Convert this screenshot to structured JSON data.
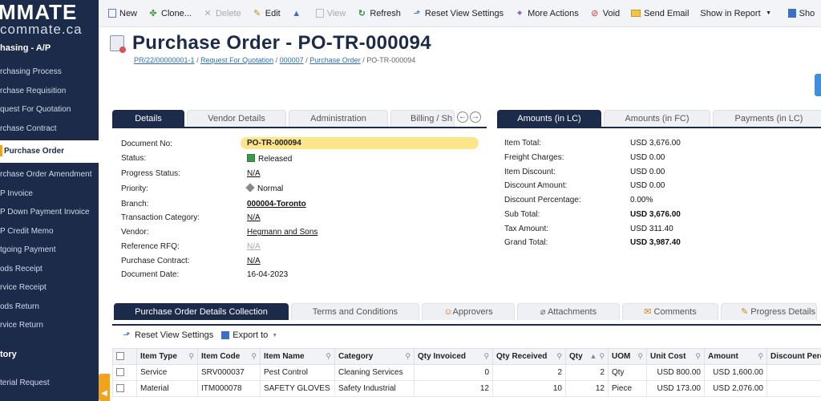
{
  "app": {
    "logo_main": "MMATE",
    "logo_sub": "commate.ca"
  },
  "sidebar": {
    "section": "hasing - A/P",
    "items": [
      {
        "label": "rchasing Process"
      },
      {
        "label": "rchase Requisition"
      },
      {
        "label": "quest For Quotation"
      },
      {
        "label": "rchase Contract"
      },
      {
        "label": "Purchase Order"
      },
      {
        "label": "rchase Order Amendment"
      },
      {
        "label": "P Invoice"
      },
      {
        "label": "P Down Payment Invoice"
      },
      {
        "label": "P Credit Memo"
      },
      {
        "label": "tgoing Payment"
      },
      {
        "label": "ods Receipt"
      },
      {
        "label": "rvice Receipt"
      },
      {
        "label": "ods Return"
      },
      {
        "label": "rvice Return"
      }
    ],
    "section2": "tory",
    "items2": [
      {
        "label": "terial Request"
      }
    ]
  },
  "toolbar": {
    "new": "New",
    "clone": "Clone...",
    "delete": "Delete",
    "edit": "Edit",
    "view": "View",
    "refresh": "Refresh",
    "reset_view": "Reset View Settings",
    "more_actions": "More Actions",
    "void": "Void",
    "send_email": "Send Email",
    "show_in_report": "Show in Report",
    "show": "Sho"
  },
  "header": {
    "title": "Purchase Order - PO-TR-000094",
    "breadcrumb": {
      "c1": "PR/22/00000001-1",
      "c2": "Request For Quotation",
      "c3": "000007",
      "c4": "Purchase Order",
      "current": "PO-TR-000094"
    }
  },
  "tabs_left": [
    "Details",
    "Vendor Details",
    "Administration",
    "Billing / Sh"
  ],
  "tabs_right": [
    "Amounts (in LC)",
    "Amounts (in FC)",
    "Payments (in LC)"
  ],
  "details": {
    "labels": {
      "doc_no": "Document No:",
      "status": "Status:",
      "progress": "Progress Status:",
      "priority": "Priority:",
      "branch": "Branch:",
      "txn_cat": "Transaction Category:",
      "vendor": "Vendor:",
      "ref_rfq": "Reference RFQ:",
      "contract": "Purchase Contract:",
      "doc_date": "Document Date:"
    },
    "values": {
      "doc_no": "PO-TR-000094",
      "status": "Released",
      "progress": "N/A",
      "priority": "Normal",
      "branch": "000004-Toronto",
      "txn_cat": "N/A",
      "vendor": "Hegmann and Sons",
      "ref_rfq": "N/A",
      "contract": "N/A",
      "doc_date": "16-04-2023"
    }
  },
  "amounts": {
    "labels": {
      "item_total": "Item Total:",
      "freight": "Freight Charges:",
      "item_disc": "Item Discount:",
      "disc_amt": "Discount Amount:",
      "disc_pct": "Discount Percentage:",
      "sub_total": "Sub Total:",
      "tax": "Tax Amount:",
      "grand": "Grand Total:"
    },
    "values": {
      "item_total": "USD 3,676.00",
      "freight": "USD 0.00",
      "item_disc": "USD 0.00",
      "disc_amt": "USD 0.00",
      "disc_pct": "0.00%",
      "sub_total": "USD 3,676.00",
      "tax": "USD 311.40",
      "grand": "USD 3,987.40"
    }
  },
  "bottom_tabs": [
    "Purchase Order Details Collection",
    "Terms and Conditions",
    "Approvers",
    "Attachments",
    "Comments",
    "Progress Details"
  ],
  "grid_toolbar": {
    "reset_view": "Reset View Settings",
    "export": "Export to"
  },
  "grid": {
    "columns": [
      "Item Type",
      "Item Code",
      "Item Name",
      "Category",
      "Qty Invoiced",
      "Qty Received",
      "Qty",
      "UOM",
      "Unit Cost",
      "Amount",
      "Discount Perc"
    ],
    "rows": [
      [
        "Service",
        "SRV000037",
        "Pest Control",
        "Cleaning Services",
        "0",
        "2",
        "2",
        "Qty",
        "USD 800.00",
        "USD 1,600.00",
        ""
      ],
      [
        "Material",
        "ITM000078",
        "SAFETY GLOVES",
        "Safety Industrial",
        "12",
        "10",
        "12",
        "Piece",
        "USD 173.00",
        "USD 2,076.00",
        ""
      ]
    ]
  }
}
